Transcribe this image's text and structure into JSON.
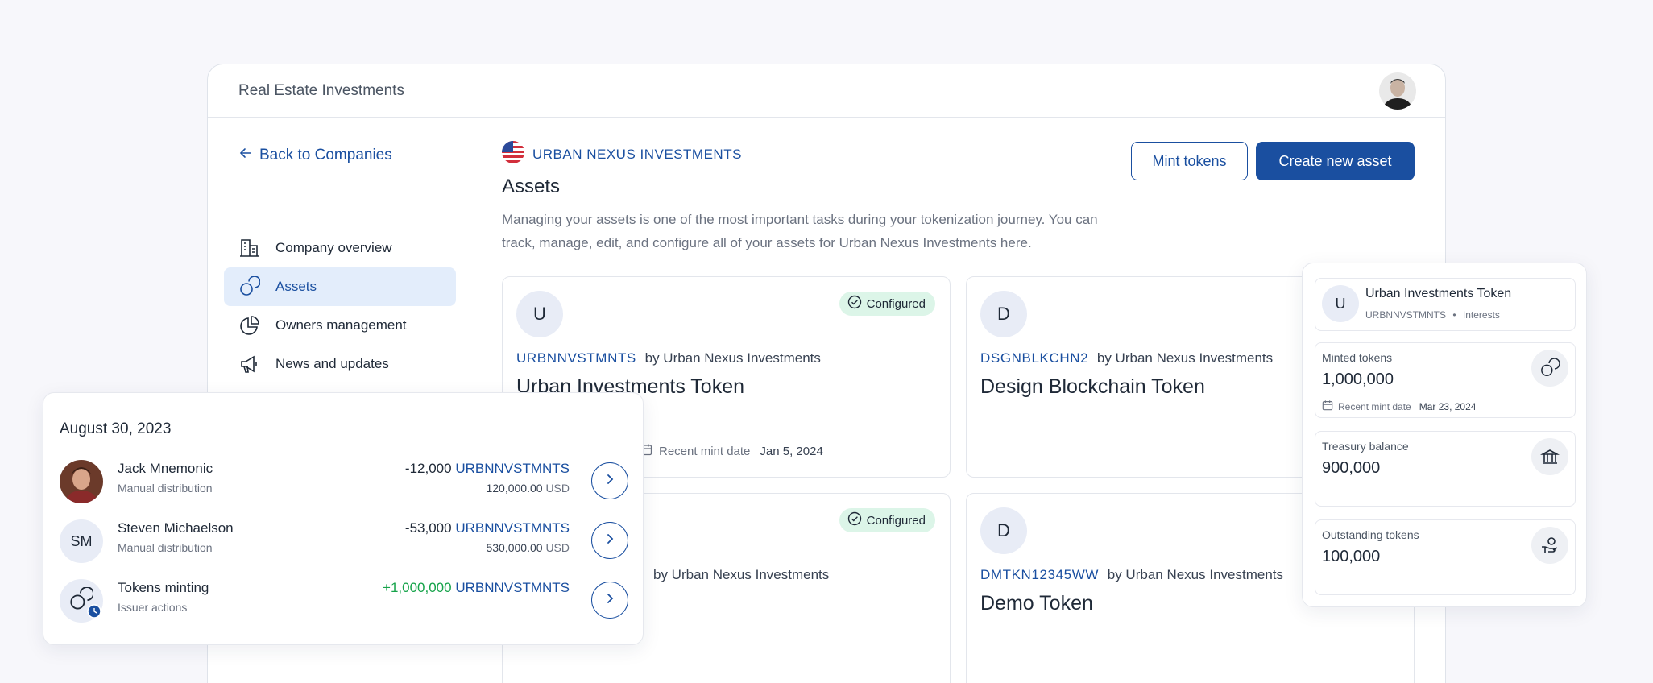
{
  "app": {
    "title": "Real Estate Investments"
  },
  "sidebar": {
    "back_label": "Back to Companies",
    "items": [
      {
        "label": "Company overview",
        "icon": "building-icon",
        "active": false
      },
      {
        "label": "Assets",
        "icon": "coins-icon",
        "active": true
      },
      {
        "label": "Owners management",
        "icon": "pie-chart-icon",
        "active": false
      },
      {
        "label": "News and updates",
        "icon": "megaphone-icon",
        "active": false
      }
    ]
  },
  "header": {
    "company": "URBAN NEXUS INVESTMENTS",
    "title": "Assets",
    "description": "Managing your assets is one of the most important tasks during your tokenization journey. You can track, manage, edit, and configure all of your assets for Urban Nexus Investments here.",
    "mint_label": "Mint tokens",
    "create_label": "Create new asset"
  },
  "assets": [
    {
      "initial": "U",
      "symbol": "URBNNVSTMNTS",
      "by": "by Urban Nexus Investments",
      "name": "Urban Investments Token",
      "status": "Configured",
      "mint_label": "Recent mint date",
      "mint_date": "Jan 5, 2024"
    },
    {
      "initial": "D",
      "symbol": "DSGNBLKCHN2",
      "by": "by Urban Nexus Investments",
      "name": "Design Blockchain Token"
    },
    {
      "initial": "",
      "symbol": "",
      "by": "by Urban Nexus Investments",
      "name": "",
      "status": "Configured"
    },
    {
      "initial": "D",
      "symbol": "DMTKN12345WW",
      "by": "by Urban Nexus Investments",
      "name": "Demo Token"
    }
  ],
  "transactions": {
    "date": "August 30, 2023",
    "rows": [
      {
        "name": "Jack Mnemonic",
        "sub": "Manual distribution",
        "amount": "-12,000",
        "token": "URBNNVSTMNTS",
        "usd": "120,000.00",
        "currency": "USD",
        "avatar": "photo"
      },
      {
        "name": "Steven Michaelson",
        "sub": "Manual distribution",
        "amount": "-53,000",
        "token": "URBNNVSTMNTS",
        "usd": "530,000.00",
        "currency": "USD",
        "initials": "SM"
      },
      {
        "name": "Tokens minting",
        "sub": "Issuer actions",
        "amount": "+1,000,000",
        "token": "URBNNVSTMNTS",
        "positive": true
      }
    ]
  },
  "token_panel": {
    "initial": "U",
    "name": "Urban Investments Token",
    "symbol": "URBNNVSTMNTS",
    "category": "Interests",
    "minted_label": "Minted tokens",
    "minted_value": "1,000,000",
    "mint_date_label": "Recent mint date",
    "mint_date": "Mar 23, 2024",
    "treasury_label": "Treasury balance",
    "treasury_value": "900,000",
    "outstanding_label": "Outstanding tokens",
    "outstanding_value": "100,000"
  },
  "colors": {
    "primary": "#1a4fa0",
    "success": "#16a34a",
    "badge_bg": "#dcf5e8",
    "active_nav": "#e3edfb"
  }
}
